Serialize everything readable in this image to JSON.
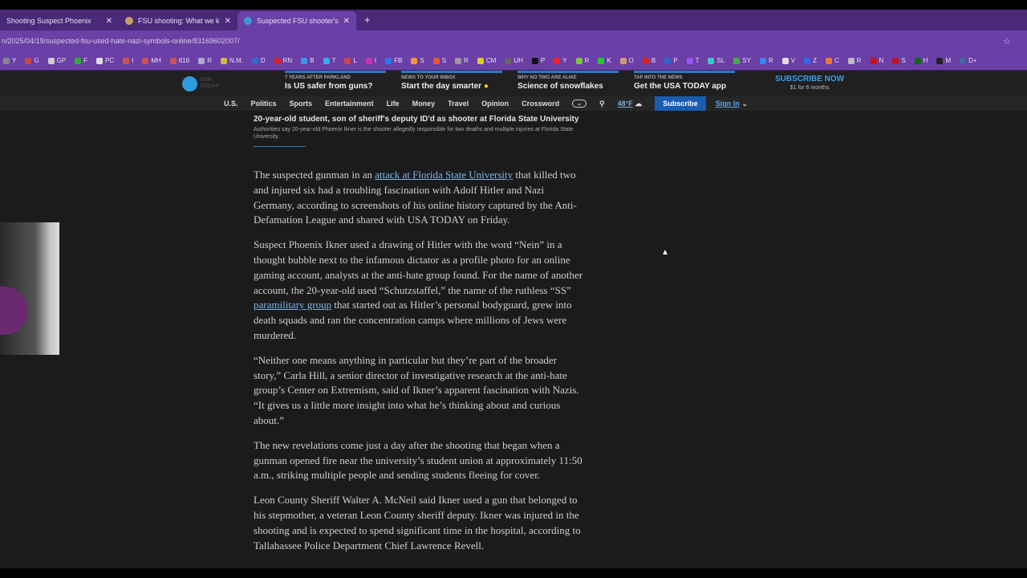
{
  "tabs": [
    {
      "title": "Shooting Suspect Phoenix"
    },
    {
      "title": "FSU shooting: What we know a"
    },
    {
      "title": "Suspected FSU shooter's web t"
    }
  ],
  "address": "n/2025/04/19/suspected-fsu-used-hate-nazi-symbols-online/83169602007/",
  "bookmarks": [
    "Y",
    "G",
    "GP",
    "F",
    "PC",
    "I",
    "MH",
    "616",
    "R",
    "N.M.",
    "D",
    "RN",
    "B",
    "T",
    "L",
    "I",
    "FB",
    "S",
    "S",
    "R",
    "CM",
    "UH",
    "P",
    "Y",
    "R",
    "K",
    "O",
    "B",
    "P",
    "T",
    "SL",
    "SY",
    "R",
    "V",
    "Z",
    "C",
    "R",
    "N",
    "S",
    "H",
    "M",
    "D+"
  ],
  "header": {
    "logo": "USA TODAY",
    "promos": [
      {
        "kicker": "7 YEARS AFTER PARKLAND",
        "title": "Is US safer from guns?"
      },
      {
        "kicker": "NEWS TO YOUR INBOX",
        "title": "Start the day smarter"
      },
      {
        "kicker": "WHY NO TWO ARE ALIKE",
        "title": "Science of snowflakes"
      },
      {
        "kicker": "TAP INTO THE NEWS",
        "title": "Get the USA TODAY app"
      }
    ],
    "subscribe": "SUBSCRIBE NOW",
    "subscribe_sub": "$1 for 6 months"
  },
  "nav": {
    "items": [
      "U.S.",
      "Politics",
      "Sports",
      "Entertainment",
      "Life",
      "Money",
      "Travel",
      "Opinion",
      "Crossword"
    ],
    "weather": "48°F",
    "subscribe": "Subscribe",
    "signin": "Sign In"
  },
  "related": {
    "title": "20-year-old student, son of sheriff's deputy ID'd as shooter at Florida State University",
    "summary": "Authorities say 20-year-old Phoenix Ikner is the shooter allegedly responsible for two deaths and multiple injuries at Florida State University."
  },
  "article": {
    "p1a": "The suspected gunman in an ",
    "p1link": "attack at Florida State University",
    "p1b": " that killed two and injured six had a troubling fascination with Adolf Hitler and Nazi Germany, according to screenshots of his online history captured by the Anti-Defamation League and shared with USA TODAY on Friday.",
    "p2a": "Suspect Phoenix Ikner used a drawing of Hitler with the word “Nein” in a thought bubble next to the infamous dictator as a profile photo for an online gaming account, analysts at the anti-hate group found. For the name of another account, the 20-year-old used “Schutzstaffel,” the name of the ruthless “SS” ",
    "p2link": "paramilitary group",
    "p2b": " that started out as Hitler’s personal bodyguard, grew into death squads and ran the concentration camps where millions of Jews were murdered.",
    "p3": "“Neither one means anything in particular but they’re part of the broader story,” Carla Hill, a senior director of investigative research at the anti-hate group’s Center on Extremism, said of Ikner’s apparent fascination with Nazis. “It gives us a little more insight into what he’s thinking about and curious about.”",
    "p4": "The new revelations come just a day after the shooting that began when a gunman opened fire near the university’s student union at approximately 11:50 a.m., striking multiple people and sending students fleeing for cover.",
    "p5": "Leon County Sheriff Walter A. McNeil said Ikner used a gun that belonged to his stepmother, a veteran Leon County sheriff deputy. Ikner was injured in the shooting and is expected to spend significant time in the hospital, according to Tallahassee Police Department Chief Lawrence Revell."
  }
}
